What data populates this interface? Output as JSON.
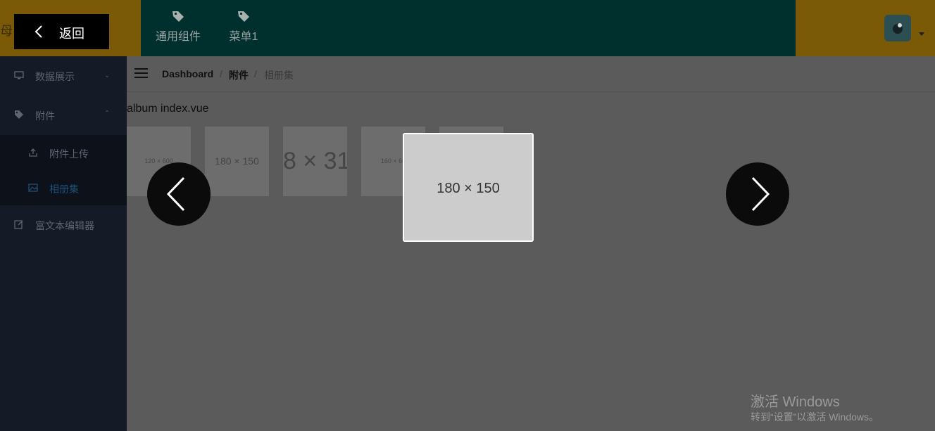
{
  "header": {
    "brand_text": "母",
    "nav": [
      {
        "label": "通用组件",
        "icon": "tag-icon"
      },
      {
        "label": "菜单1",
        "icon": "tag-icon"
      }
    ],
    "avatar_icon": "user-avatar",
    "colors": {
      "bar": "#7a5a07",
      "nav_bg": "#00302d"
    }
  },
  "sidebar": {
    "items": [
      {
        "label": "数据展示",
        "icon": "monitor-icon",
        "expanded": false
      },
      {
        "label": "附件",
        "icon": "tag-icon",
        "expanded": true
      },
      {
        "label": "富文本编辑器",
        "icon": "edit-icon",
        "expanded": false
      }
    ],
    "sub_items": [
      {
        "label": "附件上传",
        "icon": "upload-icon",
        "active": false
      },
      {
        "label": "相册集",
        "icon": "image-icon",
        "active": true
      }
    ],
    "colors": {
      "bg": "#141a26",
      "active": "#1f4f78"
    }
  },
  "breadcrumb": {
    "items": [
      "Dashboard",
      "附件",
      "相册集"
    ],
    "separator": "/"
  },
  "page": {
    "heading": "album index.vue",
    "thumbnails": [
      {
        "label": "120 × 600"
      },
      {
        "label": "180 × 150"
      },
      {
        "label": "8 × 31"
      },
      {
        "label": "160 × 60"
      },
      {
        "label": ""
      }
    ]
  },
  "viewer": {
    "back_label": "返回",
    "preview_label": "180 × 150",
    "prev_icon": "chevron-left-icon",
    "next_icon": "chevron-right-icon"
  },
  "watermark": {
    "line1": "激活 Windows",
    "line2": "转到“设置”以激活 Windows。"
  }
}
